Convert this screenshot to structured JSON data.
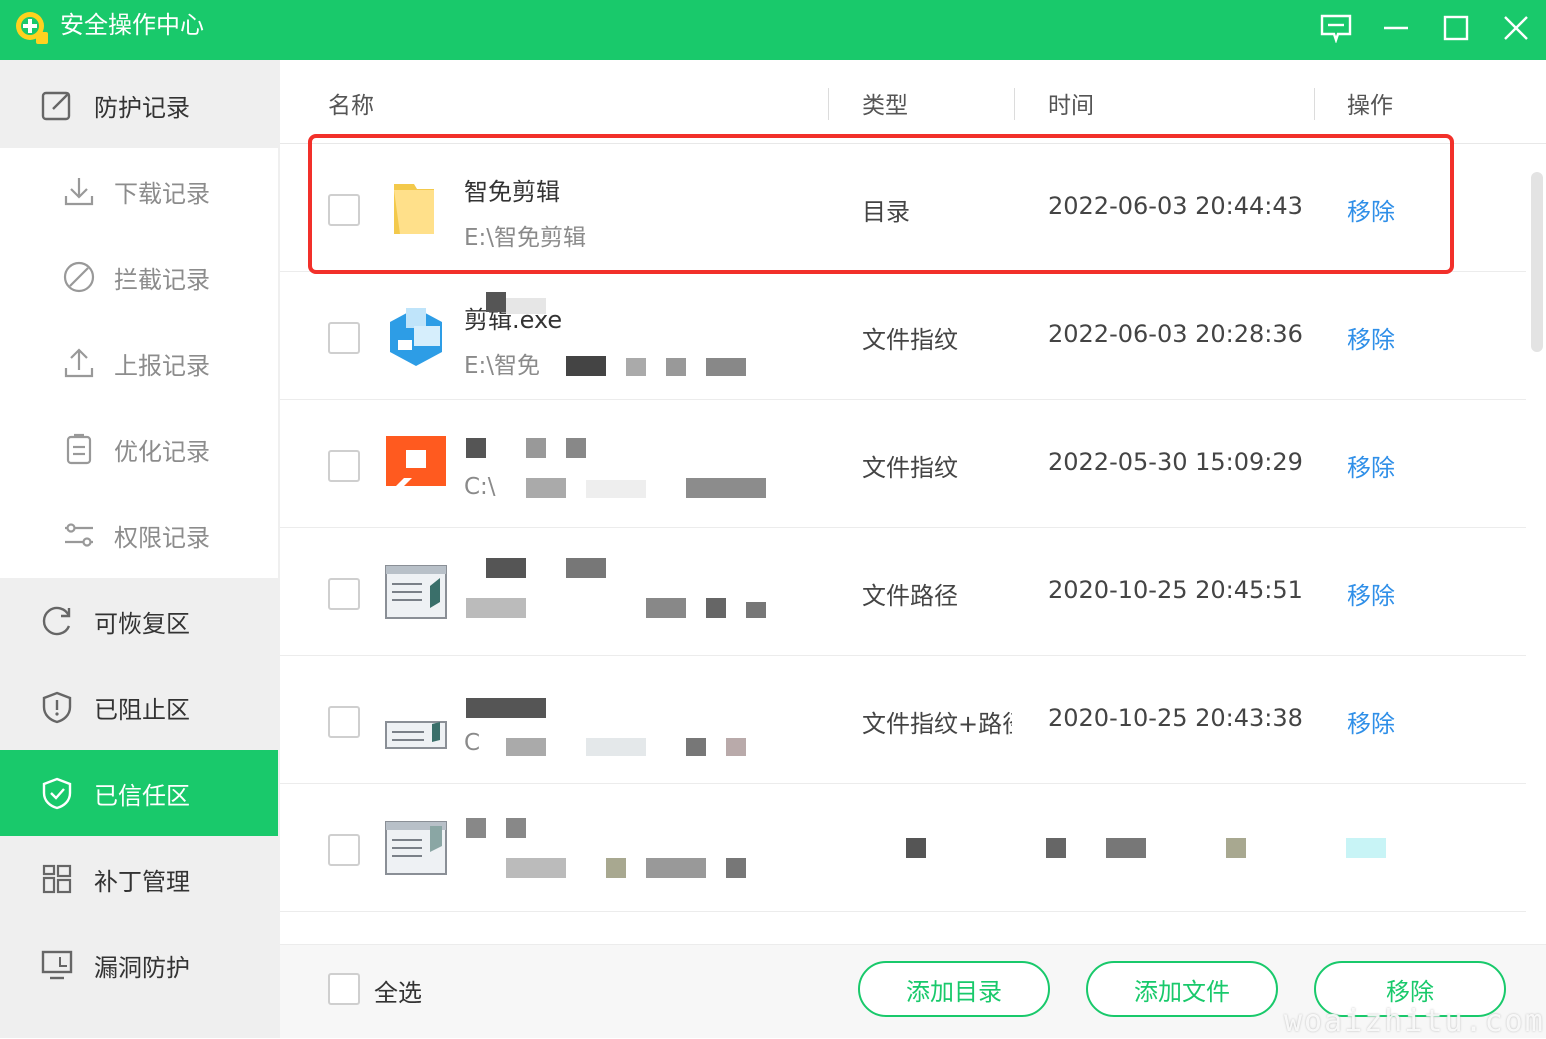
{
  "app": {
    "title": "安全操作中心",
    "accent": "#19c96b"
  },
  "window_controls": {
    "feedback": "message-square-icon",
    "minimize": "minimize-icon",
    "maximize": "maximize-icon",
    "close": "close-icon"
  },
  "sidebar": {
    "items": [
      {
        "label": "防护记录",
        "icon": "edit-icon",
        "kind": "header"
      },
      {
        "label": "下载记录",
        "icon": "download-icon",
        "kind": "sub"
      },
      {
        "label": "拦截记录",
        "icon": "block-icon",
        "kind": "sub"
      },
      {
        "label": "上报记录",
        "icon": "upload-icon",
        "kind": "sub"
      },
      {
        "label": "优化记录",
        "icon": "clipboard-icon",
        "kind": "sub"
      },
      {
        "label": "权限记录",
        "icon": "sliders-icon",
        "kind": "sub"
      },
      {
        "label": "可恢复区",
        "icon": "refresh-icon",
        "kind": "item"
      },
      {
        "label": "已阻止区",
        "icon": "shield-alert-icon",
        "kind": "item"
      },
      {
        "label": "已信任区",
        "icon": "shield-check-icon",
        "kind": "active"
      },
      {
        "label": "补丁管理",
        "icon": "grid-icon",
        "kind": "item"
      },
      {
        "label": "漏洞防护",
        "icon": "monitor-icon",
        "kind": "item"
      }
    ]
  },
  "table": {
    "columns": [
      "名称",
      "类型",
      "时间",
      "操作"
    ],
    "rows": [
      {
        "name": "智免剪辑",
        "path": "E:\\智免剪辑",
        "type": "目录",
        "time": "2022-06-03 20:44:43",
        "action": "移除",
        "icon": "folder-icon"
      },
      {
        "name": "剪辑.exe",
        "path": "E:\\智免",
        "type": "文件指纹",
        "time": "2022-06-03 20:28:36",
        "action": "移除",
        "icon": "app-icon"
      },
      {
        "name": "",
        "path": "C:\\",
        "type": "文件指纹",
        "time": "2022-05-30 15:09:29",
        "action": "移除",
        "icon": "app-icon"
      },
      {
        "name": "",
        "path": "",
        "type": "文件路径",
        "time": "2020-10-25 20:45:51",
        "action": "移除",
        "icon": "window-icon"
      },
      {
        "name": "",
        "path": "C",
        "type": "文件指纹+路径",
        "time": "2020-10-25 20:43:38",
        "action": "移除",
        "icon": "window-icon"
      },
      {
        "name": "",
        "path": "",
        "type": "",
        "time": "",
        "action": "",
        "icon": "window-icon"
      }
    ]
  },
  "footer": {
    "select_all": "全选",
    "add_dir": "添加目录",
    "add_file": "添加文件",
    "remove": "移除"
  },
  "watermark": "woaizhitu.com"
}
